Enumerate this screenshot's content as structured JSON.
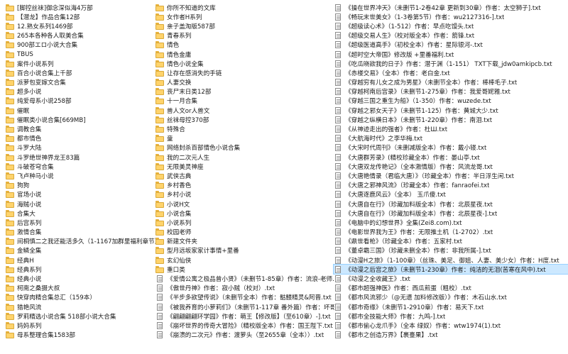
{
  "column1": [
    {
      "type": "folder",
      "name": "[脚控丝袜]御念深似海4万部"
    },
    {
      "type": "folder",
      "name": "【潜龙】作品合集12部"
    },
    {
      "type": "folder",
      "name": "12.熟女系列1469部"
    },
    {
      "type": "folder",
      "name": "265本各种各人取美合集"
    },
    {
      "type": "folder",
      "name": "900部エロ小说大合集"
    },
    {
      "type": "folder",
      "name": "TBUS"
    },
    {
      "type": "folder",
      "name": "案件小说系列"
    },
    {
      "type": "folder",
      "name": "百合小说合集上千部"
    },
    {
      "type": "folder",
      "name": "派萝包变嫁文合集"
    },
    {
      "type": "folder",
      "name": "超多小说"
    },
    {
      "type": "folder",
      "name": "纯爱母系小说258部"
    },
    {
      "type": "folder",
      "name": "催眠"
    },
    {
      "type": "folder",
      "name": "催眠类小说合集[669MB]"
    },
    {
      "type": "folder",
      "name": "调教合集"
    },
    {
      "type": "folder",
      "name": "都市情色"
    },
    {
      "type": "folder",
      "name": "斗罗大陆"
    },
    {
      "type": "folder",
      "name": "斗罗绝世神界龙王83篇"
    },
    {
      "type": "folder",
      "name": "斗破苍穹合集"
    },
    {
      "type": "folder",
      "name": "飞卢种马小说"
    },
    {
      "type": "folder",
      "name": "狗狗"
    },
    {
      "type": "folder",
      "name": "官场小说"
    },
    {
      "type": "folder",
      "name": "海贼小说"
    },
    {
      "type": "folder",
      "name": "合集大"
    },
    {
      "type": "folder",
      "name": "后宫系列"
    },
    {
      "type": "folder",
      "name": "激情合集"
    },
    {
      "type": "folder",
      "name": "间桐慎二之我还能活多久（1-1167加群里福利章节）"
    },
    {
      "type": "folder",
      "name": "金鳞全集"
    },
    {
      "type": "folder",
      "name": "经典H"
    },
    {
      "type": "folder",
      "name": "经典系列"
    },
    {
      "type": "folder",
      "name": "经典小说"
    },
    {
      "type": "folder",
      "name": "柯南之桑摄大叔"
    },
    {
      "type": "folder",
      "name": "快穿肉精合集总汇（159本）"
    },
    {
      "type": "folder",
      "name": "猎艳风流"
    },
    {
      "type": "folder",
      "name": "罗莉精选小说合集 518部小说大合集"
    },
    {
      "type": "folder",
      "name": "妈妈系列"
    },
    {
      "type": "folder",
      "name": "母系整理合集1583部"
    }
  ],
  "column2": [
    {
      "type": "folder",
      "name": "你所不知道的文库"
    },
    {
      "type": "folder",
      "name": "女作者H系列"
    },
    {
      "type": "folder",
      "name": "亲子盖淘版587部"
    },
    {
      "type": "folder",
      "name": "青春系列"
    },
    {
      "type": "folder",
      "name": "情色"
    },
    {
      "type": "folder",
      "name": "情色金庸"
    },
    {
      "type": "folder",
      "name": "情色小说全集"
    },
    {
      "type": "folder",
      "name": "让存在感消失的手链"
    },
    {
      "type": "folder",
      "name": "人妻交换"
    },
    {
      "type": "folder",
      "name": "丧尸末日类12部"
    },
    {
      "type": "folder",
      "name": "十一月合集"
    },
    {
      "type": "folder",
      "name": "兽人文or人兽文"
    },
    {
      "type": "folder",
      "name": "丝袜母控370部"
    },
    {
      "type": "folder",
      "name": "特殊合"
    },
    {
      "type": "folder",
      "name": "童"
    },
    {
      "type": "folder",
      "name": "网络封杀百部情色小说合集"
    },
    {
      "type": "folder",
      "name": "我的二次元人生"
    },
    {
      "type": "folder",
      "name": "无限美灵神座"
    },
    {
      "type": "folder",
      "name": "武侠古典"
    },
    {
      "type": "folder",
      "name": "乡村香色"
    },
    {
      "type": "folder",
      "name": "乡村小说"
    },
    {
      "type": "folder",
      "name": "小说H文"
    },
    {
      "type": "folder",
      "name": "小说合集"
    },
    {
      "type": "folder",
      "name": "小说系列"
    },
    {
      "type": "folder",
      "name": "校园老师"
    },
    {
      "type": "folder",
      "name": "新建文件夹"
    },
    {
      "type": "folder",
      "name": "型月远坂家家计事情+里番"
    },
    {
      "type": "folder",
      "name": "玄幻仙侠"
    },
    {
      "type": "folder",
      "name": "重口类"
    },
    {
      "type": "file",
      "name": "《爱情公寓之极品曾小贤》（未删节1-85章）作者：流浪-老师.txt"
    },
    {
      "type": "file",
      "name": "《傲世丹神》作者：寂小贼（校对）.txt"
    },
    {
      "type": "file",
      "name": "《半步多欲望传说》（未删节全本）作者：骷髅精灵&阿晋.txt"
    },
    {
      "type": "file",
      "name": "《被我养育的小萝莉们》（未删节1-117章 番外篇）作者：坏哥哥.txt"
    },
    {
      "type": "file",
      "name": "《翩翩翩翩环学园》作者：萌王【修改版】（至610章）-].txt"
    },
    {
      "type": "file",
      "name": "《崩坏世界的传奇大冒险》（精校版全本）作者：国王陛下.txt"
    },
    {
      "type": "file",
      "name": "《崩溃的二次元》作者：渡萝头（至2655章（全本））.txt"
    }
  ],
  "column3": [
    {
      "type": "file",
      "name": "《操在世界冲天》（未删节1-2卷42章 更新到30章）作者：太空狮子].txt"
    },
    {
      "type": "file",
      "name": "《畅玩末世美女》（1-3卷第5节）作者：wu2127316-].txt"
    },
    {
      "type": "file",
      "name": "《超级读心术》（1-512）作者：早点吃馒头.txt"
    },
    {
      "type": "file",
      "name": "《超级交易人生》（校对版全本）作者：箭锋.txt"
    },
    {
      "type": "file",
      "name": "《超级医道高手》（初校全本）作者：星际银河-.txt"
    },
    {
      "type": "file",
      "name": "《超时空大帝国》修改版 +里番福利.txt"
    },
    {
      "type": "file",
      "name": "《吃瓜晓欲我的日子》作者：潜于渊（1-151） TXT下载_jdw0amkipcb.txt"
    },
    {
      "type": "file",
      "name": "《赤楼交易》（全本）作者：老白金.txt"
    },
    {
      "type": "file",
      "name": "《穿越穷有儿女之成为男星》（未删节全本）作者：棒棒毛子.txt"
    },
    {
      "type": "file",
      "name": "《穿越柯南后宫录》（未删节1-275章）作者：我爱哥妮雅.txt"
    },
    {
      "type": "file",
      "name": "《穿越三国之重生为船》（1-350）作者：wuzede.txt"
    },
    {
      "type": "file",
      "name": "《穿越之邪女天子》（未删节1-125）作者：黄城大少.txt"
    },
    {
      "type": "file",
      "name": "《穿越之纵横日本》（未删节1-220章）作者：南泪.txt"
    },
    {
      "type": "file",
      "name": "《从神迹走出的强者》作者：杜Ш.txt"
    },
    {
      "type": "file",
      "name": "《大航海时代》之李华梅.txt"
    },
    {
      "type": "file",
      "name": "《大宋时代周刊》（未删减版全本）作者：戴小镂.txt"
    },
    {
      "type": "file",
      "name": "《大唐群芳录》(精校珍藏全本）作者：晏山亭.txt"
    },
    {
      "type": "file",
      "name": "《大唐双龙传艳记》（全本激情版）作者：风流龙哥.txt"
    },
    {
      "type": "file",
      "name": "《大唐艳情录（君临大唐）》（珍藏全本）作者：半日浮生闲.txt"
    },
    {
      "type": "file",
      "name": "《大唐之邪神风流》（珍藏全本）作者：fanraofei.txt"
    },
    {
      "type": "file",
      "name": "《大唐逐鹿风云》（全本） 玉爪傻.txt"
    },
    {
      "type": "file",
      "name": "《大唐自在行》（珍藏加料版全本）作者：北辰星夜.txt"
    },
    {
      "type": "file",
      "name": "《大唐自在行》（珍藏加料版全本）作者：北辰星夜-].txt"
    },
    {
      "type": "file",
      "name": "《电脑中的幻想世界》全集(Zei8.com).txt"
    },
    {
      "type": "file",
      "name": "《电影世界我为王》作者：无限推土机（1-2702）.txt"
    },
    {
      "type": "file",
      "name": "《鼎世看枪》（珍藏全本）作者：五家村.txt"
    },
    {
      "type": "file",
      "name": "《董卓霸三国》（珍藏未删全本）作者：非我所属-].txt"
    },
    {
      "type": "file",
      "name": "《动漫H之旅》（1-100章）（丝珠、美足、御姐、人妻、美少女）作者：H度.txt"
    },
    {
      "type": "file",
      "name": "《动漫之后宫之旅》（未删节1-230章）作者：纯洁的无泪(苦寒在风中).txt"
    },
    {
      "type": "file",
      "name": "《动漫之全收藏王》.txt"
    },
    {
      "type": "file",
      "name": "《都市超强神医》作者：西瓜煎蛋（粗校）.txt"
    },
    {
      "type": "file",
      "name": "《都市风流邪少（@无遗 加料修改版）》作者：木石山水.txt"
    },
    {
      "type": "file",
      "name": "《都市奇缘》（未删节1-2910章）作者：易天下.txt"
    },
    {
      "type": "file",
      "name": "《都市全技能大师》作者：九鸣-].txt"
    },
    {
      "type": "file",
      "name": "《都市偷心龙爪手》（全本 绿奴）作者：wtw1974(1).txt"
    },
    {
      "type": "file",
      "name": "《都市之创造万界》【裹臺果】.txt"
    }
  ]
}
